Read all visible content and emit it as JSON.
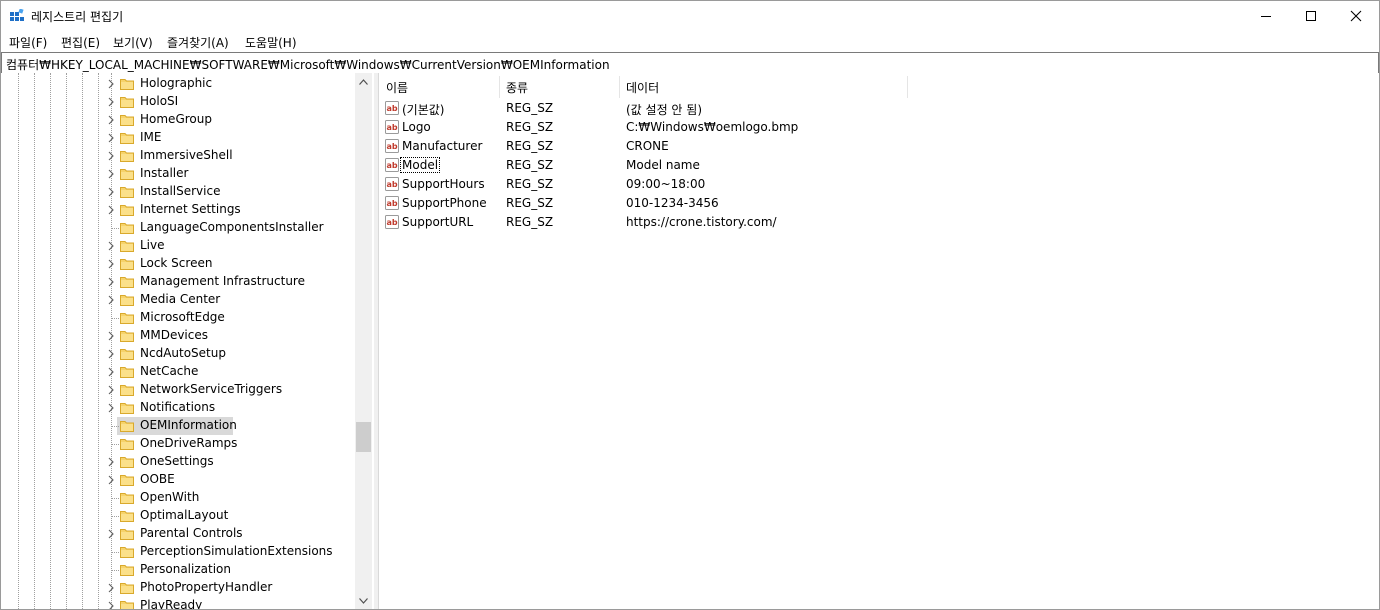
{
  "window": {
    "title": "레지스트리 편집기",
    "icon": "registry-editor-icon",
    "controls": [
      "minimize-icon",
      "maximize-icon",
      "close-icon"
    ]
  },
  "menu": [
    {
      "label": "파일(F)"
    },
    {
      "label": "편집(E)"
    },
    {
      "label": "보기(V)"
    },
    {
      "label": "즐겨찾기(A)"
    },
    {
      "label": "도움말(H)"
    }
  ],
  "address": "컴퓨터₩HKEY_LOCAL_MACHINE₩SOFTWARE₩Microsoft₩Windows₩CurrentVersion₩OEMInformation",
  "tree": {
    "items": [
      {
        "label": "Holographic",
        "expandable": true
      },
      {
        "label": "HoloSI",
        "expandable": true
      },
      {
        "label": "HomeGroup",
        "expandable": true
      },
      {
        "label": "IME",
        "expandable": true
      },
      {
        "label": "ImmersiveShell",
        "expandable": true
      },
      {
        "label": "Installer",
        "expandable": true
      },
      {
        "label": "InstallService",
        "expandable": true
      },
      {
        "label": "Internet Settings",
        "expandable": true
      },
      {
        "label": "LanguageComponentsInstaller",
        "expandable": false
      },
      {
        "label": "Live",
        "expandable": true
      },
      {
        "label": "Lock Screen",
        "expandable": true
      },
      {
        "label": "Management Infrastructure",
        "expandable": true
      },
      {
        "label": "Media Center",
        "expandable": true
      },
      {
        "label": "MicrosoftEdge",
        "expandable": false
      },
      {
        "label": "MMDevices",
        "expandable": true
      },
      {
        "label": "NcdAutoSetup",
        "expandable": true
      },
      {
        "label": "NetCache",
        "expandable": true
      },
      {
        "label": "NetworkServiceTriggers",
        "expandable": true
      },
      {
        "label": "Notifications",
        "expandable": true
      },
      {
        "label": "OEMInformation",
        "expandable": false,
        "selected": true
      },
      {
        "label": "OneDriveRamps",
        "expandable": false
      },
      {
        "label": "OneSettings",
        "expandable": true
      },
      {
        "label": "OOBE",
        "expandable": true
      },
      {
        "label": "OpenWith",
        "expandable": false
      },
      {
        "label": "OptimalLayout",
        "expandable": false
      },
      {
        "label": "Parental Controls",
        "expandable": true
      },
      {
        "label": "PerceptionSimulationExtensions",
        "expandable": false
      },
      {
        "label": "Personalization",
        "expandable": false
      },
      {
        "label": "PhotoPropertyHandler",
        "expandable": true
      },
      {
        "label": "PlayReady",
        "expandable": true
      }
    ]
  },
  "list": {
    "columns": {
      "name": "이름",
      "type": "종류",
      "data": "데이터"
    },
    "rows": [
      {
        "name": "(기본값)",
        "type": "REG_SZ",
        "data": "(값 설정 안 됨)"
      },
      {
        "name": "Logo",
        "type": "REG_SZ",
        "data": "C:₩Windows₩oemlogo.bmp"
      },
      {
        "name": "Manufacturer",
        "type": "REG_SZ",
        "data": "CRONE"
      },
      {
        "name": "Model",
        "type": "REG_SZ",
        "data": "Model name",
        "focused": true
      },
      {
        "name": "SupportHours",
        "type": "REG_SZ",
        "data": "09:00~18:00"
      },
      {
        "name": "SupportPhone",
        "type": "REG_SZ",
        "data": "010-1234-3456"
      },
      {
        "name": "SupportURL",
        "type": "REG_SZ",
        "data": "https://crone.tistory.com/"
      }
    ]
  },
  "colors": {
    "folder": "#f6d36b",
    "selection": "#d9d9d9",
    "value_icon": "#c0392b"
  }
}
